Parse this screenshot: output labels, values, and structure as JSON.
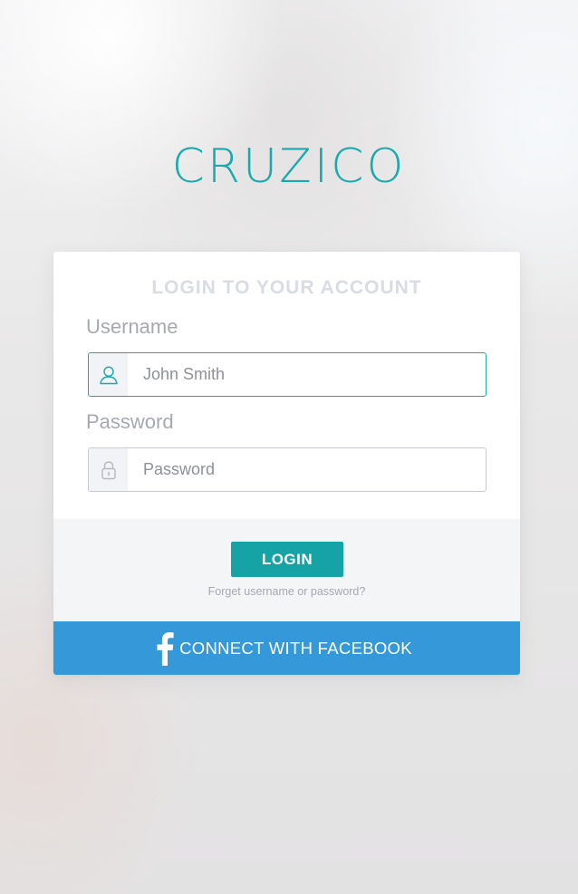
{
  "app": {
    "brand": "CRUZICO"
  },
  "login_card": {
    "title": "LOGIN TO YOUR ACCOUNT",
    "username": {
      "label": "Username",
      "placeholder": "John Smith",
      "icon": "user-icon"
    },
    "password": {
      "label": "Password",
      "placeholder": "Password",
      "icon": "lock-icon"
    },
    "login_label": "LOGIN",
    "forgot_link": "Forget username or password?",
    "facebook": {
      "label": "CONNECT WITH FACEBOOK",
      "icon": "facebook-icon"
    }
  },
  "colors": {
    "accent": "#1aa9ad",
    "login_button": "#16a3a5",
    "facebook": "#3498d9",
    "footer_panel": "#f4f5f7"
  }
}
